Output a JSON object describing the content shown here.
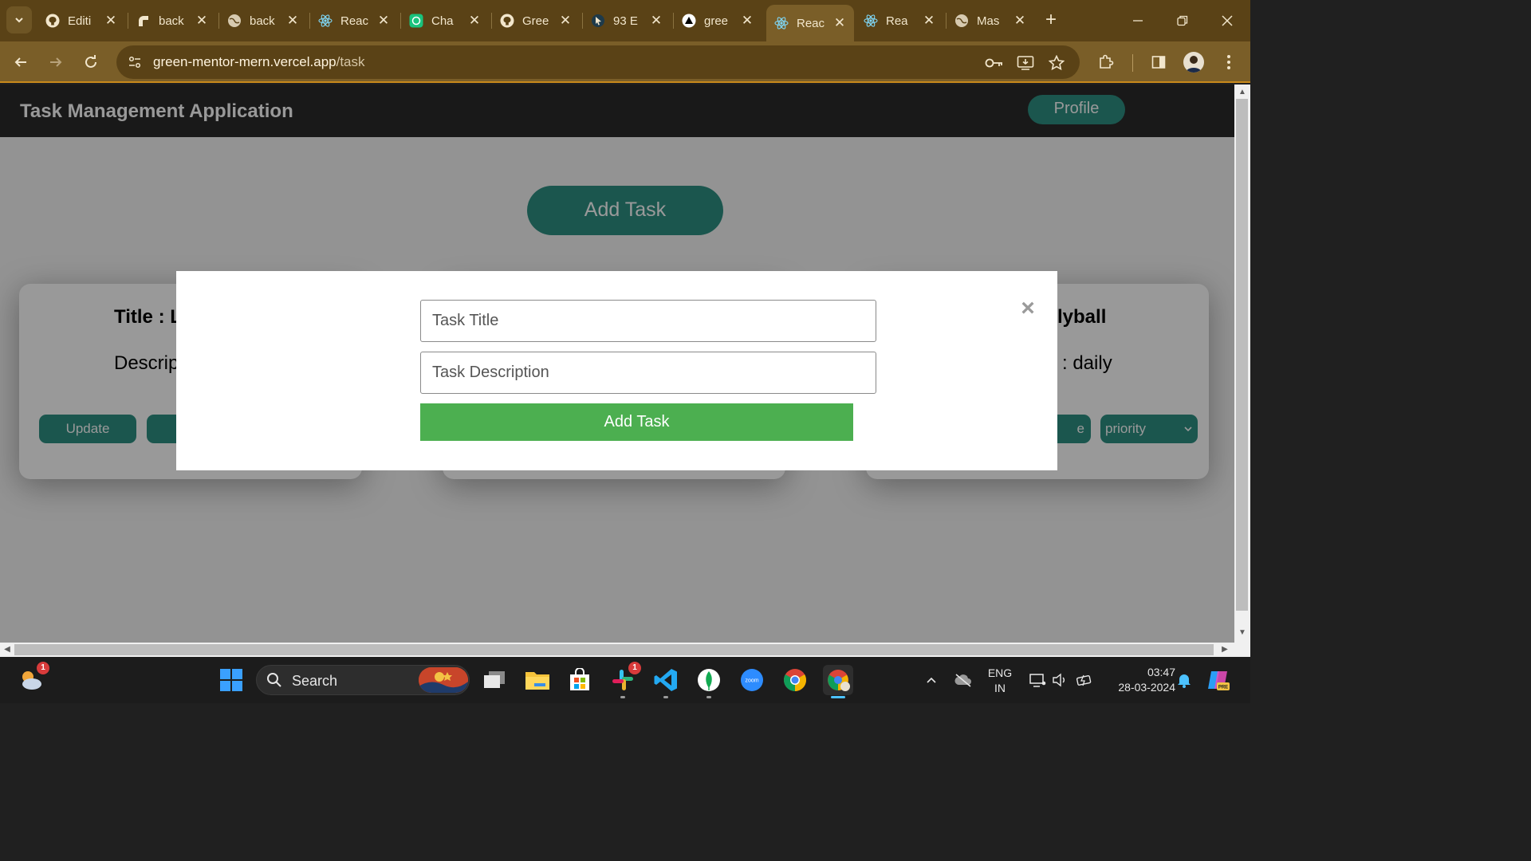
{
  "browser": {
    "tabs": [
      {
        "title": "Editi",
        "icon": "github-icon"
      },
      {
        "title": "back",
        "icon": "render-icon"
      },
      {
        "title": "back",
        "icon": "globe-icon"
      },
      {
        "title": "Reac",
        "icon": "react-icon"
      },
      {
        "title": "Cha",
        "icon": "chatgpt-icon"
      },
      {
        "title": "Gree",
        "icon": "github-icon"
      },
      {
        "title": "93 E",
        "icon": "cursor-icon"
      },
      {
        "title": "gree",
        "icon": "vercel-icon"
      },
      {
        "title": "Reac",
        "icon": "react-icon",
        "active": true
      },
      {
        "title": "Rea",
        "icon": "react-icon"
      },
      {
        "title": "Mas",
        "icon": "globe-icon"
      }
    ],
    "close_glyph": "✕",
    "new_tab_glyph": "+",
    "url_host": "green-mentor-mern.vercel.app",
    "url_path": "/task",
    "colors": {
      "tabbar": "#5a4216",
      "toolbar": "#7a5e28"
    }
  },
  "app": {
    "title": "Task Management Application",
    "profile_label": "Profile",
    "add_task_label": "Add Task",
    "accent": "#2d8f83",
    "cards": [
      {
        "title": "Title : L",
        "desc": "Descrip",
        "update_label": "Update"
      },
      {
        "title": "lyball",
        "desc": ": daily",
        "partial_button_label": "e",
        "priority_label": "priority"
      }
    ]
  },
  "modal": {
    "title_placeholder": "Task Title",
    "description_placeholder": "Task Description",
    "submit_label": "Add Task",
    "close_glyph": "×",
    "submit_color": "#4caf50"
  },
  "taskbar": {
    "search_label": "Search",
    "weather_badge": "1",
    "slack_badge": "1",
    "zoom_label": "zoom",
    "lang_top": "ENG",
    "lang_bottom": "IN",
    "time": "03:47",
    "date": "28-03-2024",
    "copilot_label": "PRE"
  }
}
